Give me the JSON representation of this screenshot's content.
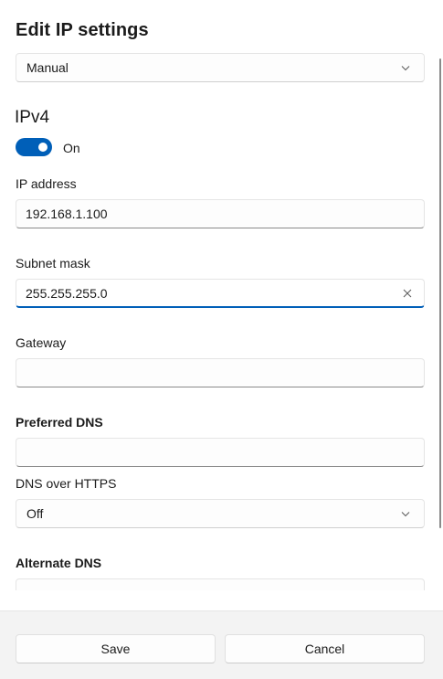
{
  "dialog": {
    "title": "Edit IP settings",
    "mode_dropdown": {
      "value": "Manual",
      "icon": "chevron-down-icon"
    }
  },
  "ipv4": {
    "heading": "IPv4",
    "toggle": {
      "state": "On",
      "on": true,
      "accent": "#005fb8"
    },
    "ip_address": {
      "label": "IP address",
      "value": "192.168.1.100"
    },
    "subnet_mask": {
      "label": "Subnet mask",
      "value": "255.255.255.0",
      "clear_icon": "close-icon"
    },
    "gateway": {
      "label": "Gateway",
      "value": ""
    },
    "preferred_dns": {
      "label": "Preferred DNS",
      "value": ""
    },
    "dns_over_https": {
      "label": "DNS over HTTPS",
      "value": "Off",
      "icon": "chevron-down-icon"
    },
    "alternate_dns": {
      "label": "Alternate DNS",
      "value": ""
    }
  },
  "footer": {
    "save_label": "Save",
    "cancel_label": "Cancel"
  }
}
